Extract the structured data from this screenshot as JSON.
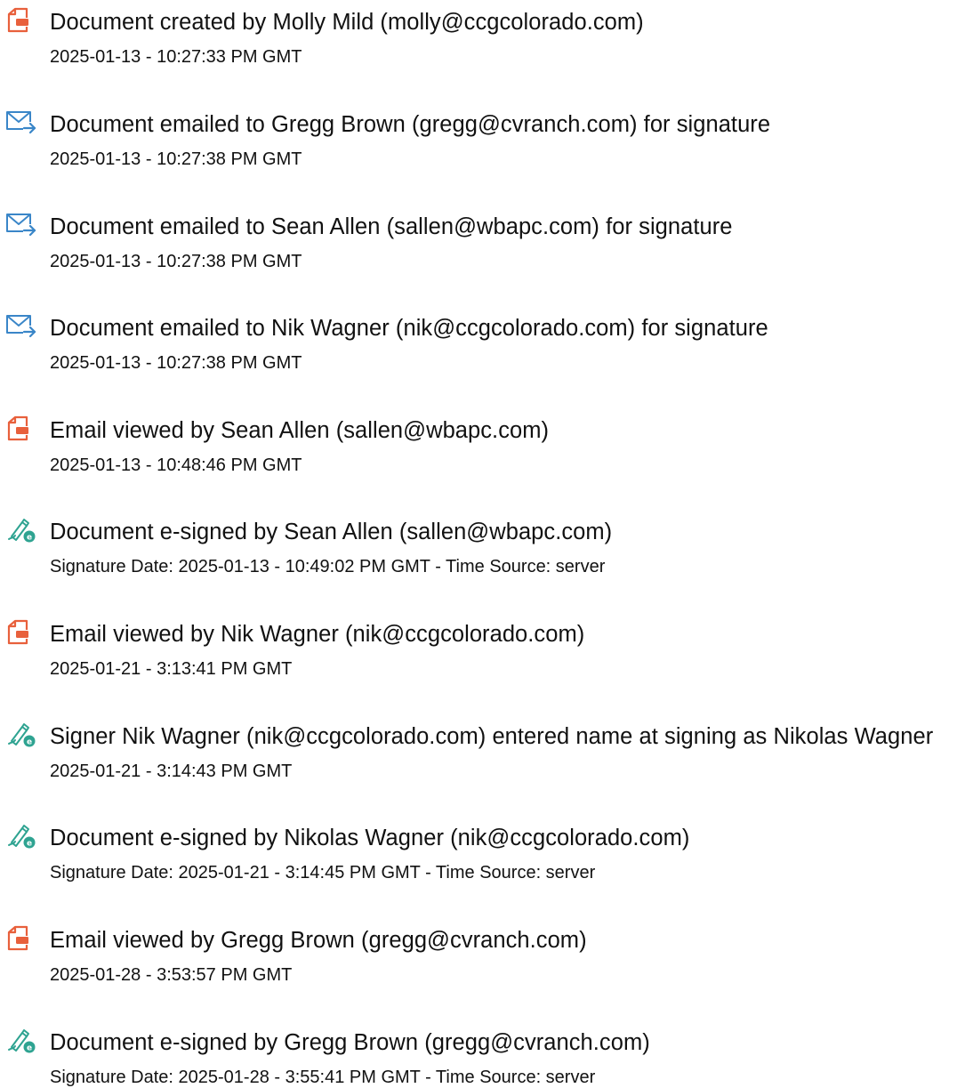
{
  "colors": {
    "document_icon": "#e8603c",
    "email_icon": "#3a86c8",
    "signature_icon": "#2ea391"
  },
  "events": [
    {
      "icon": "document-icon",
      "title": "Document created by Molly Mild (molly@ccgcolorado.com)",
      "detail": "2025-01-13 - 10:27:33 PM GMT"
    },
    {
      "icon": "email-sent-icon",
      "title": "Document emailed to Gregg Brown (gregg@cvranch.com) for signature",
      "detail": "2025-01-13 - 10:27:38 PM GMT"
    },
    {
      "icon": "email-sent-icon",
      "title": "Document emailed to Sean Allen (sallen@wbapc.com) for signature",
      "detail": "2025-01-13 - 10:27:38 PM GMT"
    },
    {
      "icon": "email-sent-icon",
      "title": "Document emailed to Nik Wagner (nik@ccgcolorado.com) for signature",
      "detail": "2025-01-13 - 10:27:38 PM GMT"
    },
    {
      "icon": "document-icon",
      "title": "Email viewed by Sean Allen (sallen@wbapc.com)",
      "detail": "2025-01-13 - 10:48:46 PM GMT"
    },
    {
      "icon": "e-signature-icon",
      "title": "Document e-signed by Sean Allen (sallen@wbapc.com)",
      "detail": "Signature Date: 2025-01-13 - 10:49:02 PM GMT - Time Source: server"
    },
    {
      "icon": "document-icon",
      "title": "Email viewed by Nik Wagner (nik@ccgcolorado.com)",
      "detail": "2025-01-21 - 3:13:41 PM GMT"
    },
    {
      "icon": "e-signature-icon",
      "title": "Signer Nik Wagner (nik@ccgcolorado.com) entered name at signing as Nikolas Wagner",
      "detail": "2025-01-21 - 3:14:43 PM GMT"
    },
    {
      "icon": "e-signature-icon",
      "title": "Document e-signed by Nikolas Wagner (nik@ccgcolorado.com)",
      "detail": "Signature Date: 2025-01-21 - 3:14:45 PM GMT - Time Source: server"
    },
    {
      "icon": "document-icon",
      "title": "Email viewed by Gregg Brown (gregg@cvranch.com)",
      "detail": "2025-01-28 - 3:53:57 PM GMT"
    },
    {
      "icon": "e-signature-icon",
      "title": "Document e-signed by Gregg Brown (gregg@cvranch.com)",
      "detail": "Signature Date: 2025-01-28 - 3:55:41 PM GMT - Time Source: server"
    }
  ]
}
